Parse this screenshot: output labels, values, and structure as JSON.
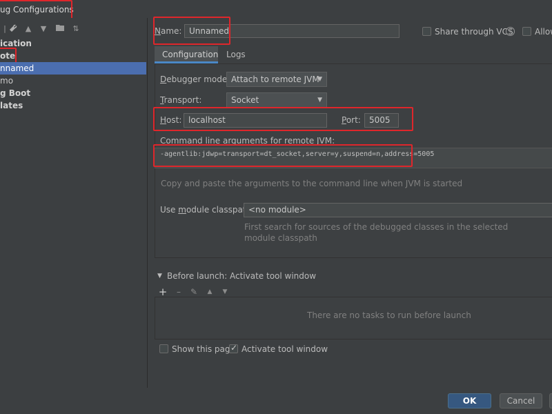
{
  "window": {
    "title": "ug Configurations"
  },
  "sidebar": {
    "items": [
      {
        "label": "ication",
        "bold": true
      },
      {
        "label": "ote",
        "bold": true
      },
      {
        "label": "nnamed",
        "bold": false,
        "selected": true
      },
      {
        "label": "mo",
        "bold": false
      },
      {
        "label": "g Boot",
        "bold": true
      },
      {
        "label": "lates",
        "bold": true
      }
    ],
    "toolbar_icons": [
      "wrench-icon",
      "arrow-up-icon",
      "arrow-down-icon",
      "folder-add-icon",
      "sort-icon"
    ]
  },
  "header": {
    "name_label": "Name:",
    "name_value": "Unnamed",
    "share_vcs_label": "Share through VCS",
    "share_vcs_checked": false,
    "allow_label": "Allow",
    "allow_checked": false
  },
  "tabs": [
    {
      "label": "Configuration",
      "selected": true
    },
    {
      "label": "Logs",
      "selected": false
    }
  ],
  "config": {
    "debugger_mode_label": "Debugger mode:",
    "debugger_mode_value": "Attach to remote JVM",
    "transport_label": "Transport:",
    "transport_value": "Socket",
    "host_label": "Host:",
    "host_value": "localhost",
    "port_label": "Port:",
    "port_value": "5005",
    "cmd_label": "Command line arguments for remote JVM:",
    "cmd_value": "-agentlib:jdwp=transport=dt_socket,server=y,suspend=n,address=5005",
    "cmd_hint": "Copy and paste the arguments to the command line when JVM is started",
    "module_classpath_label": "Use module classpath:",
    "module_classpath_value": "<no module>",
    "module_hint_line1": "First search for sources of the debugged classes in the selected",
    "module_hint_line2": "module classpath"
  },
  "before_launch": {
    "title": "Before launch: Activate tool window",
    "empty_text": "There are no tasks to run before launch",
    "show_page_label": "Show this page",
    "show_page_checked": false,
    "activate_tool_window_label": "Activate tool window",
    "activate_tool_window_checked": true
  },
  "footer": {
    "ok_label": "OK",
    "cancel_label": "Cancel"
  },
  "colors": {
    "background": "#3c3f41",
    "selection": "#4b6eaf",
    "highlight_box": "#e0262b",
    "primary_button": "#365880"
  }
}
